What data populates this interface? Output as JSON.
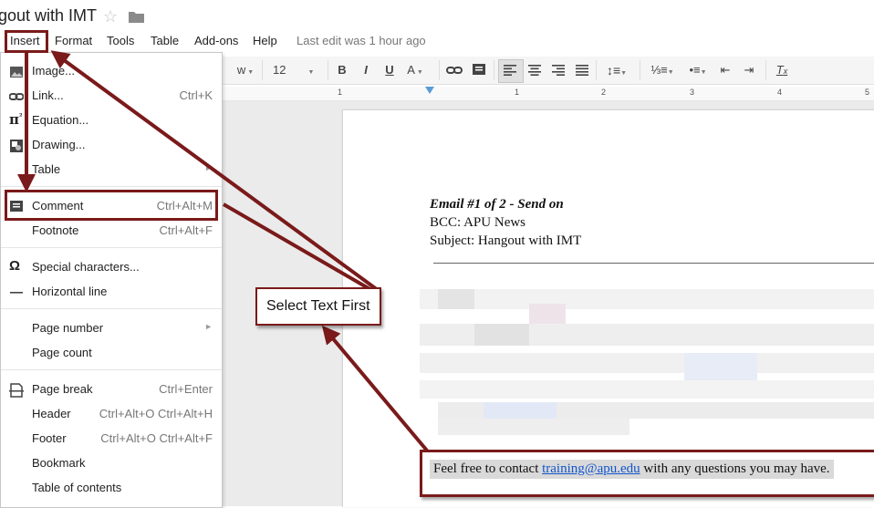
{
  "header": {
    "doc_title": "gout with IMT",
    "star_icon": "star-outline-icon",
    "folder_icon": "folder-icon"
  },
  "menubar": {
    "items": [
      "Insert",
      "Format",
      "Tools",
      "Table",
      "Add-ons",
      "Help"
    ],
    "last_edit": "Last edit was 1 hour ago"
  },
  "toolbar": {
    "font_size": "12",
    "font_name_fragment": "w"
  },
  "ruler": {
    "numbers": [
      "1",
      "1",
      "2",
      "3",
      "4",
      "5"
    ]
  },
  "insert_menu": {
    "items": [
      {
        "label": "Image...",
        "shortcut": "",
        "icon": "image-icon"
      },
      {
        "label": "Link...",
        "shortcut": "Ctrl+K",
        "icon": "link-icon"
      },
      {
        "label": "Equation...",
        "shortcut": "",
        "icon": "pi-equation-icon"
      },
      {
        "label": "Drawing...",
        "shortcut": "",
        "icon": "drawing-icon"
      },
      {
        "label": "Table",
        "shortcut": "",
        "icon": "",
        "submenu": true
      },
      {
        "label": "Comment",
        "shortcut": "Ctrl+Alt+M",
        "icon": "comment-icon"
      },
      {
        "label": "Footnote",
        "shortcut": "Ctrl+Alt+F",
        "icon": ""
      },
      {
        "label": "Special characters...",
        "shortcut": "",
        "icon": "omega-icon"
      },
      {
        "label": "Horizontal line",
        "shortcut": "",
        "icon": "horizontal-line-icon"
      },
      {
        "label": "Page number",
        "shortcut": "",
        "icon": "",
        "submenu": true
      },
      {
        "label": "Page count",
        "shortcut": "",
        "icon": ""
      },
      {
        "label": "Page break",
        "shortcut": "Ctrl+Enter",
        "icon": "page-break-icon"
      },
      {
        "label": "Header",
        "shortcut": "Ctrl+Alt+O Ctrl+Alt+H",
        "icon": ""
      },
      {
        "label": "Footer",
        "shortcut": "Ctrl+Alt+O Ctrl+Alt+F",
        "icon": ""
      },
      {
        "label": "Bookmark",
        "shortcut": "",
        "icon": ""
      },
      {
        "label": "Table of contents",
        "shortcut": "",
        "icon": ""
      }
    ]
  },
  "document": {
    "email_heading": "Email #1 of 2 - Send on",
    "bcc_line": "BCC: APU News",
    "subject_line": "Subject: Hangout with IMT",
    "contact_before": "Feel free to contact ",
    "contact_link": "training@apu.edu",
    "contact_after": " with any questions you may have."
  },
  "annotation": {
    "callout_text": "Select Text First",
    "highlight_color": "#7a1a1a"
  }
}
